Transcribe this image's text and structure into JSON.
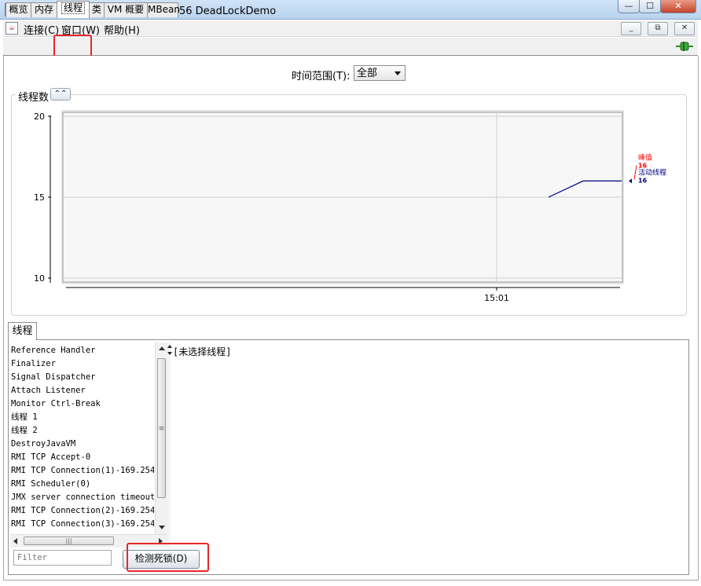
{
  "window": {
    "title": "Java 监视和管理控制台 - pid: 43756 DeadLockDemo",
    "app_icon": "java-cup-icon"
  },
  "window_controls": {
    "minimize": "—",
    "maximize": "☐",
    "close": "✕"
  },
  "menubar": {
    "items": [
      "连接(C)",
      "窗口(W)",
      "帮助(H)"
    ],
    "mdi_minimize": "_",
    "mdi_restore": "⧉",
    "mdi_close": "✕"
  },
  "tabs": {
    "items": [
      "概览",
      "内存",
      "线程",
      "类",
      "VM 概要",
      "MBean"
    ],
    "active": "线程"
  },
  "time_range": {
    "label": "时间范围(T):",
    "value": "全部"
  },
  "chart_panel": {
    "title": "线程数",
    "collapse_icon": "double-chevron-up-icon"
  },
  "chart_data": {
    "type": "line",
    "ylim": [
      10,
      20
    ],
    "y_ticks": [
      "20",
      "15",
      "10"
    ],
    "x_ticks": [
      "15:01"
    ],
    "series": [
      {
        "name": "活动线程",
        "color": "#000080",
        "values": [
          15,
          16,
          16
        ],
        "value_label": "16"
      },
      {
        "name": "峰值",
        "color": "#ff0000",
        "value_label": "16"
      }
    ]
  },
  "bottom_tabs": {
    "items": [
      "线程"
    ]
  },
  "thread_list": {
    "items": [
      "Reference Handler",
      "Finalizer",
      "Signal Dispatcher",
      "Attach Listener",
      "Monitor Ctrl-Break",
      "线程 1",
      "线程 2",
      "DestroyJavaVM",
      "RMI TCP Accept-0",
      "RMI TCP Connection(1)-169.254.",
      "RMI Scheduler(0)",
      "JMX server connection timeout",
      "RMI TCP Connection(2)-169.254.",
      "RMI TCP Connection(3)-169.254."
    ]
  },
  "detail": {
    "text": "[未选择线程]"
  },
  "filter": {
    "placeholder": "Filter"
  },
  "detect_deadlock_button": {
    "label": "检测死锁(D)"
  },
  "highlight_color": "#e8262a"
}
